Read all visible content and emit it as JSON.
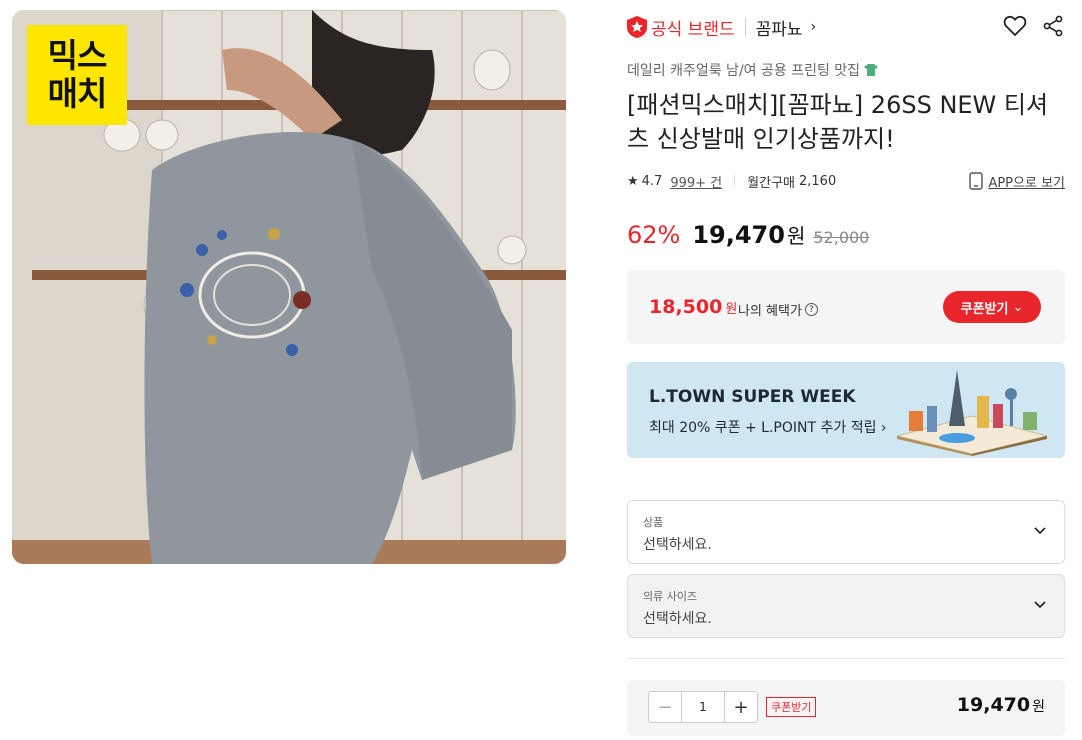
{
  "image": {
    "badge_line1": "믹스",
    "badge_line2": "매치"
  },
  "brand": {
    "official_label": "공식 브랜드",
    "name": "꼼파뇨",
    "accent": "#e8262c"
  },
  "product": {
    "subtitle": "데일리 캐주얼룩 남/여 공용 프린팅 맛집",
    "title": "[패션믹스매치][꼼파뇨] 26SS NEW 티셔츠 신상발매 인기상품까지!",
    "rating": "4.7",
    "reviews": "999+ 건",
    "monthly_label": "월간구매",
    "monthly_count": "2,160",
    "app_link": "APP으로 보기"
  },
  "price": {
    "discount": "62%",
    "sale": "19,470",
    "unit": "원",
    "original": "52,000"
  },
  "benefit": {
    "price": "18,500",
    "unit": "원",
    "label": "나의 혜택가",
    "help": "?",
    "coupon_button": "쿠폰받기"
  },
  "banner": {
    "title": "L.TOWN SUPER WEEK",
    "subtitle": "최대 20% 쿠폰 + L.POINT 추가 적립 ›"
  },
  "options": [
    {
      "label": "상품",
      "value": "선택하세요."
    },
    {
      "label": "의류 사이즈",
      "value": "선택하세요."
    }
  ],
  "order": {
    "minus": "−",
    "quantity": "1",
    "plus": "+",
    "coupon_tag": "쿠폰받기",
    "total": "19,470",
    "unit": "원"
  }
}
